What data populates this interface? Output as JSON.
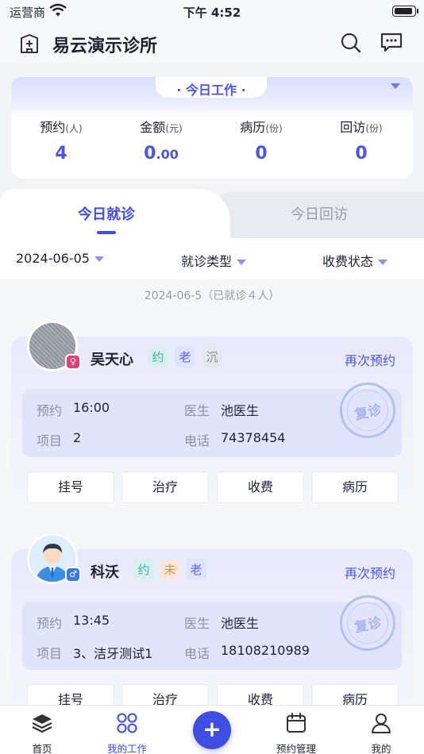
{
  "status_bar": {
    "carrier": "运营商",
    "time": "下午 4:52"
  },
  "header": {
    "title": "易云演示诊所"
  },
  "summary": {
    "title": "· 今日工作 ·",
    "stats": [
      {
        "label": "预约",
        "unit": "(人)",
        "value": "4"
      },
      {
        "label": "金额",
        "unit": "(元)",
        "value_int": "0",
        "value_dec": ".00"
      },
      {
        "label": "病历",
        "unit": "(份)",
        "value": "0"
      },
      {
        "label": "回访",
        "unit": "(份)",
        "value": "0"
      }
    ]
  },
  "tabs": {
    "active": "今日就诊",
    "inactive": "今日回访"
  },
  "filters": {
    "date": "2024-06-05",
    "type": "就诊类型",
    "fee": "收费状态"
  },
  "list": {
    "caption": "2024-06-5（已就诊４人）",
    "rebook_label": "再次预约",
    "stamp_label": "复诊",
    "info_keys": {
      "appt": "预约",
      "item": "项目",
      "doctor": "医生",
      "phone": "电话"
    },
    "actions": [
      "挂号",
      "治疗",
      "收费",
      "病历"
    ],
    "patients": [
      {
        "name": "吴天心",
        "gender": "female",
        "gender_symbol": "♀",
        "tags": [
          "约",
          "老",
          "沉"
        ],
        "time": "16:00",
        "item": "2",
        "doctor": "池医生",
        "phone": "74378454"
      },
      {
        "name": "科沃",
        "gender": "male",
        "gender_symbol": "♂",
        "tags": [
          "约",
          "未",
          "老"
        ],
        "time": "13:45",
        "item": "3、洁牙测试1",
        "doctor": "池医生",
        "phone": "18108210989"
      }
    ]
  },
  "tabbar": {
    "items": [
      {
        "label": "首页",
        "icon": "layers-icon"
      },
      {
        "label": "我的工作",
        "icon": "grid-circles-icon",
        "active": true
      },
      {
        "label": "+",
        "icon": "add-icon"
      },
      {
        "label": "预约管理",
        "icon": "calendar-icon"
      },
      {
        "label": "我的",
        "icon": "person-icon"
      }
    ]
  },
  "colors": {
    "accent": "#3f4de0",
    "tag_yue": "#3bb3a7",
    "tag_lao": "#5966e0",
    "tag_wei": "#f08651"
  }
}
